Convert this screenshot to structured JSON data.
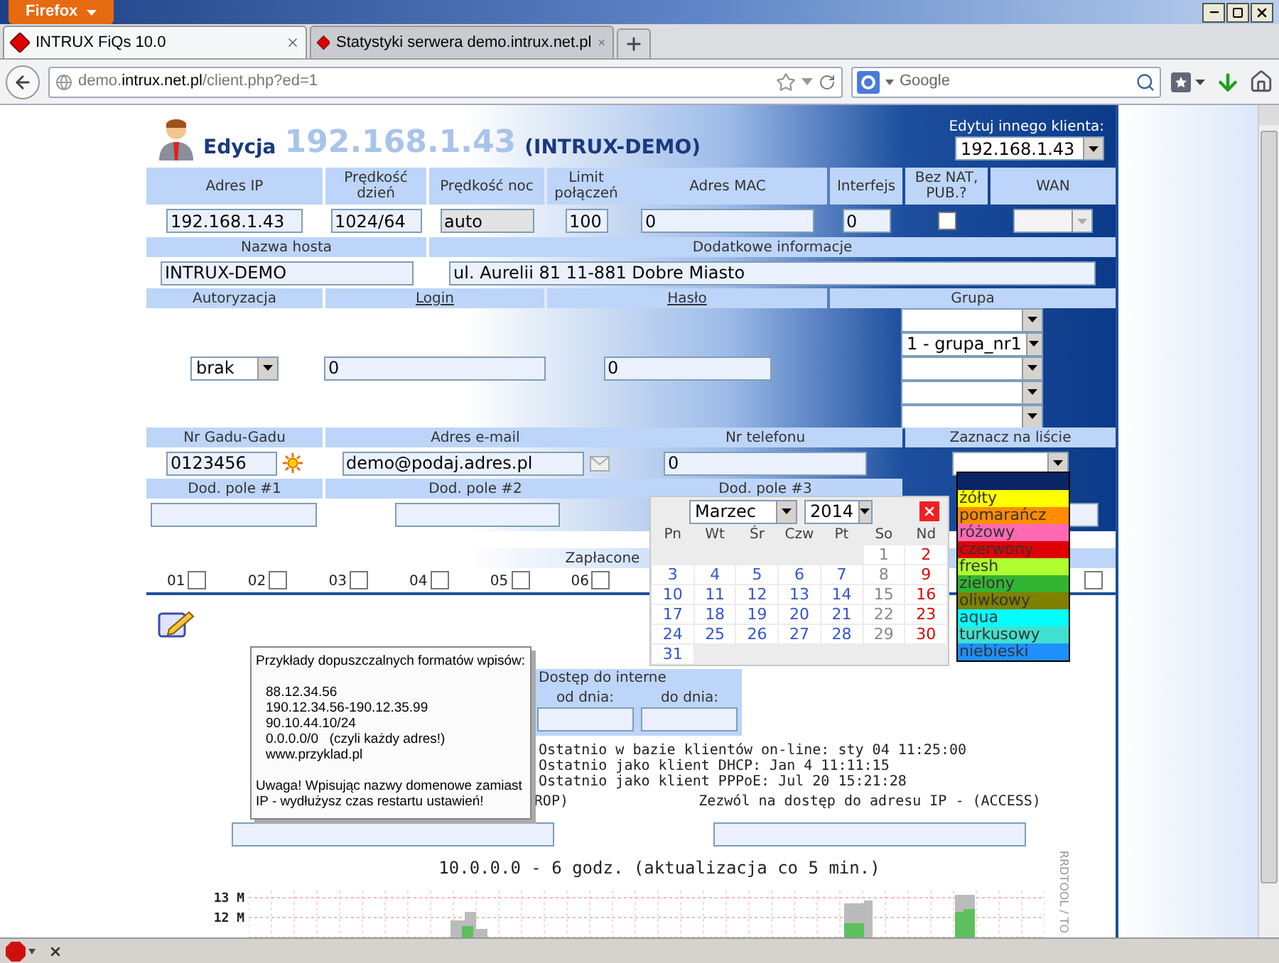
{
  "browser": {
    "menu_button": "Firefox",
    "tabs": [
      {
        "title": "INTRUX FiQs 10.0",
        "selected": true
      },
      {
        "title": "Statystyki serwera demo.intrux.net.pl",
        "selected": false
      }
    ],
    "address": [
      {
        "text": "demo.",
        "emphasis": false
      },
      {
        "text": "intrux.net.pl",
        "emphasis": true
      },
      {
        "text": "/client.php?ed=1",
        "emphasis": false
      }
    ],
    "search_placeholder": "Google"
  },
  "page": {
    "heading": {
      "title": "Edycja",
      "ip": "192.168.1.43",
      "client": "(INTRUX-DEMO)"
    },
    "client_picker": {
      "label": "Edytuj innego klienta:",
      "value": "192.168.1.43"
    },
    "network_fields": [
      {
        "label": "Adres IP",
        "kind": "input",
        "value": "192.168.1.43",
        "disabled": false
      },
      {
        "label": "Prędkość dzień",
        "kind": "input",
        "value": "1024/64",
        "disabled": false
      },
      {
        "label": "Prędkość noc",
        "kind": "input",
        "value": "auto",
        "disabled": true
      },
      {
        "label": "Limit połączeń",
        "kind": "input",
        "value": "100",
        "disabled": false
      },
      {
        "label": "Adres MAC",
        "kind": "input",
        "value": "0",
        "disabled": false
      },
      {
        "label": "Interfejs",
        "kind": "input",
        "value": "0",
        "disabled": false
      },
      {
        "label": "Bez NAT, PUB.?",
        "kind": "checkbox",
        "checked": false
      },
      {
        "label": "WAN",
        "kind": "select",
        "disabled": true
      }
    ],
    "host_fields": [
      {
        "label": "Nazwa hosta",
        "value": "INTRUX-DEMO"
      },
      {
        "label": "Dodatkowe informacje",
        "value": "ul. Aurelii 81 11-881 Dobre Miasto"
      }
    ],
    "auth_columns": [
      {
        "label": "Autoryzacja",
        "link": false
      },
      {
        "label": "Login",
        "link": true
      },
      {
        "label": "Hasło",
        "link": true
      },
      {
        "label": "Grupa",
        "link": false
      }
    ],
    "authorization": "brak",
    "login": "0",
    "password": "0",
    "groups": [
      {
        "kind": "empty"
      },
      {
        "kind": "value",
        "value": "1 - grupa_nr1"
      },
      {
        "kind": "empty"
      },
      {
        "kind": "empty"
      },
      {
        "kind": "empty"
      }
    ],
    "contact_fields": [
      {
        "label": "Nr Gadu-Gadu",
        "kind": "gadu",
        "value": "0123456"
      },
      {
        "label": "Adres e-mail",
        "kind": "email",
        "value": "demo@podaj.adres.pl"
      },
      {
        "label": "Nr telefonu",
        "kind": "input",
        "value": "0"
      },
      {
        "label": "Zaznacz na liście",
        "kind": "select"
      }
    ],
    "extra_fields": [
      {
        "kind": "labeled",
        "label": "Dod. pole #1"
      },
      {
        "kind": "labeled",
        "label": "Dod. pole #2"
      },
      {
        "kind": "labeled",
        "label": "Dod. pole #3"
      },
      {
        "kind": "unlabeled"
      }
    ],
    "paid": {
      "label": "Zapłacone",
      "months": [
        {
          "kind": "labeled",
          "label": "01",
          "checked": false
        },
        {
          "kind": "labeled",
          "label": "02",
          "checked": false
        },
        {
          "kind": "labeled",
          "label": "03",
          "checked": false
        },
        {
          "kind": "labeled",
          "label": "04",
          "checked": false
        },
        {
          "kind": "labeled",
          "label": "05",
          "checked": false
        },
        {
          "kind": "labeled",
          "label": "06",
          "checked": false
        },
        {
          "kind": "unlabeled",
          "checked": false
        }
      ]
    },
    "access_period": {
      "title": "Dostęp do interne",
      "from": "od dnia:",
      "to": "do dnia:"
    },
    "history": [
      "Ostatnio w bazie klientów on-line: sty 04 11:25:00",
      "Ostatnio jako klient DHCP: Jan 4 11:11:15",
      "Ostatnio jako klient PPPoE: Jul 20 15:21:28"
    ],
    "access_lists": [
      "ROP)",
      "Zezwól na dostęp do adresu IP - (ACCESS)"
    ],
    "graph": {
      "title": "10.0.0.0 - 6 godz. (aktualizacja co 5 min.)",
      "y_labels": [
        "13 M",
        "12 M"
      ],
      "side_label": "RRDTOOL / TO"
    },
    "hint": {
      "title": "Przykłady dopuszczalnych formatów wpisów:",
      "examples": [
        "88.12.34.56",
        "190.12.34.56-190.12.35.99",
        "90.10.44.10/24",
        "0.0.0.0/0   (czyli każdy adres!)",
        "www.przyklad.pl"
      ],
      "warning": "Uwaga! Wpisując nazwy domenowe zamiast IP - wydłużysz czas restartu ustawień!"
    },
    "calendar": {
      "month": "Marzec",
      "year": "2014",
      "weekdays": [
        "Pn",
        "Wt",
        "Śr",
        "Czw",
        "Pt",
        "So",
        "Nd"
      ],
      "weeks": [
        {
          "kind": "end_aligned",
          "days": [
            "1",
            "2"
          ]
        },
        {
          "kind": "full",
          "days": [
            "3",
            "4",
            "5",
            "6",
            "7",
            "8",
            "9"
          ]
        },
        {
          "kind": "full",
          "days": [
            "10",
            "11",
            "12",
            "13",
            "14",
            "15",
            "16"
          ]
        },
        {
          "kind": "full",
          "days": [
            "17",
            "18",
            "19",
            "20",
            "21",
            "22",
            "23"
          ]
        },
        {
          "kind": "full",
          "days": [
            "24",
            "25",
            "26",
            "27",
            "28",
            "29",
            "30"
          ]
        },
        {
          "kind": "start_aligned",
          "days": [
            "31"
          ]
        }
      ]
    },
    "color_menu": [
      {
        "selected": true
      },
      {
        "label": "żółty",
        "color": "#ffff00",
        "selected": false
      },
      {
        "label": "pomarańcz",
        "color": "#ff8c00",
        "selected": false
      },
      {
        "label": "różowy",
        "color": "#ff69b4",
        "selected": false
      },
      {
        "label": "czerwony",
        "color": "#e00000",
        "selected": false
      },
      {
        "label": "fresh",
        "color": "#adff2f",
        "selected": false
      },
      {
        "label": "zielony",
        "color": "#32b432",
        "selected": false
      },
      {
        "label": "oliwkowy",
        "color": "#808000",
        "selected": false
      },
      {
        "label": "aqua",
        "color": "#00ffff",
        "selected": false
      },
      {
        "label": "turkusowy",
        "color": "#40e0d0",
        "selected": false
      },
      {
        "label": "niebieski",
        "color": "#1e90ff",
        "selected": false
      }
    ]
  }
}
